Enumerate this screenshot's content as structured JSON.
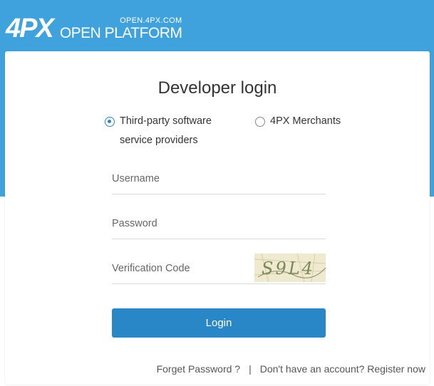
{
  "header": {
    "logo_mark": "4PX",
    "logo_url": "OPEN.4PX.COM",
    "logo_text": "OPEN PLATFORM",
    "color": "#3fa2dc"
  },
  "login": {
    "title": "Developer login",
    "roles": [
      {
        "label_line1": "Third-party software",
        "label_line2": "service providers",
        "checked": true
      },
      {
        "label_line1": "4PX Merchants",
        "checked": false
      }
    ],
    "username_placeholder": "Username",
    "password_placeholder": "Password",
    "verification_placeholder": "Verification Code",
    "captcha_text": "S9L4",
    "login_label": "Login",
    "button_color": "#2a87c7"
  },
  "footer": {
    "forget_password": "Forget Password ?",
    "separator": "|",
    "register": "Don't have an account? Register now"
  }
}
